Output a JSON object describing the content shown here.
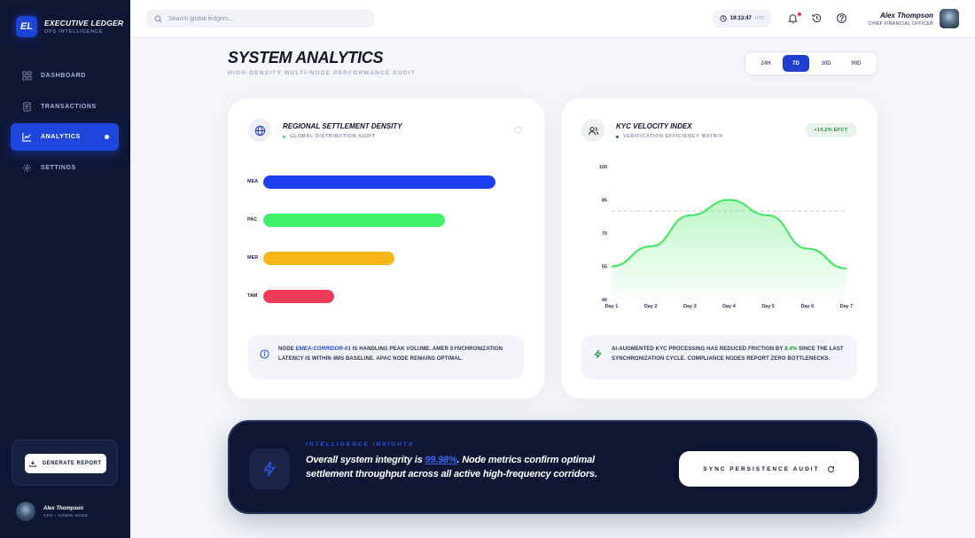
{
  "brand": {
    "logo": "EL",
    "title": "EXECUTIVE LEDGER",
    "subtitle": "OPS INTELLIGENCE"
  },
  "sidebar": {
    "items": [
      {
        "label": "DASHBOARD",
        "icon": "grid-icon",
        "active": false
      },
      {
        "label": "TRANSACTIONS",
        "icon": "document-icon",
        "active": false
      },
      {
        "label": "ANALYTICS",
        "icon": "chart-icon",
        "active": true
      },
      {
        "label": "SETTINGS",
        "icon": "gear-icon",
        "active": false
      }
    ],
    "report_button": "GENERATE REPORT",
    "user": {
      "name": "Alex Thompson",
      "role": "CFO • ADMIN NODE"
    }
  },
  "header": {
    "search_placeholder": "Search global ledgers...",
    "time": "19:13:47",
    "timezone": "UTC",
    "user": {
      "name": "Alex Thompson",
      "role": "CHIEF FINANCIAL OFFICER"
    }
  },
  "page": {
    "title": "SYSTEM ANALYTICS",
    "subtitle": "HIGH-DENSITY MULTI-NODE PERFORMANCE AUDIT",
    "ranges": [
      "24H",
      "7D",
      "30D",
      "90D"
    ],
    "active_range": "7D"
  },
  "regional": {
    "title": "REGIONAL SETTLEMENT DENSITY",
    "subtitle": "GLOBAL DISTRIBUTION AUDIT",
    "note": {
      "prefix": "NODE ",
      "highlight": "EMEA-CORRIDOR-01",
      "suffix": " IS HANDLING PEAK VOLUME. AMER SYNCHRONIZATION LATENCY IS WITHIN 4MS BASELINE. APAC NODE REMAINS OPTIMAL."
    }
  },
  "kyc": {
    "title": "KYC VELOCITY INDEX",
    "subtitle": "VERIFICATION EFFICIENCY MATRIX",
    "badge": "+14.2% EFCY",
    "note": {
      "prefix": "AI-AUGMENTED KYC PROCESSING HAS REDUCED FRICTION BY ",
      "highlight": "8.4%",
      "suffix": " SINCE THE LAST SYNCHRONIZATION CYCLE. COMPLIANCE NODES REPORT ZERO BOTTLENECKS."
    }
  },
  "insights": {
    "kicker": "INTELLIGENCE INSIGHTS",
    "text_prefix": "Overall system integrity is ",
    "highlight": "99.98%",
    "text_suffix": ". Node metrics confirm optimal settlement throughput across all active high-frequency corridors.",
    "button": "SYNC PERSISTENCE AUDIT"
  },
  "colors": {
    "accent": "#1e3fd0",
    "sidebar": "#0e1633",
    "green": "#3ee85c",
    "bar_blue": "#1e3ff0",
    "bar_green": "#3ef06a",
    "bar_yellow": "#f6b716",
    "bar_red": "#ee3b57"
  },
  "chart_data": [
    {
      "type": "bar",
      "orientation": "horizontal",
      "categories": [
        "MEA",
        "PAC",
        "MER",
        "TAM"
      ],
      "values": [
        92,
        72,
        52,
        28
      ],
      "xlim": [
        0,
        100
      ],
      "colors": [
        "#1e3ff0",
        "#3ef06a",
        "#f6b716",
        "#ee3b57"
      ]
    },
    {
      "type": "area",
      "x": [
        "Day 1",
        "Day 2",
        "Day 3",
        "Day 4",
        "Day 5",
        "Day 6",
        "Day 7"
      ],
      "values": [
        55,
        64,
        78,
        85,
        78,
        63,
        54
      ],
      "ylim": [
        40,
        100
      ],
      "yticks": [
        100,
        85,
        70,
        55,
        40
      ],
      "reference_line": 80,
      "color": "#3ee85c"
    }
  ]
}
